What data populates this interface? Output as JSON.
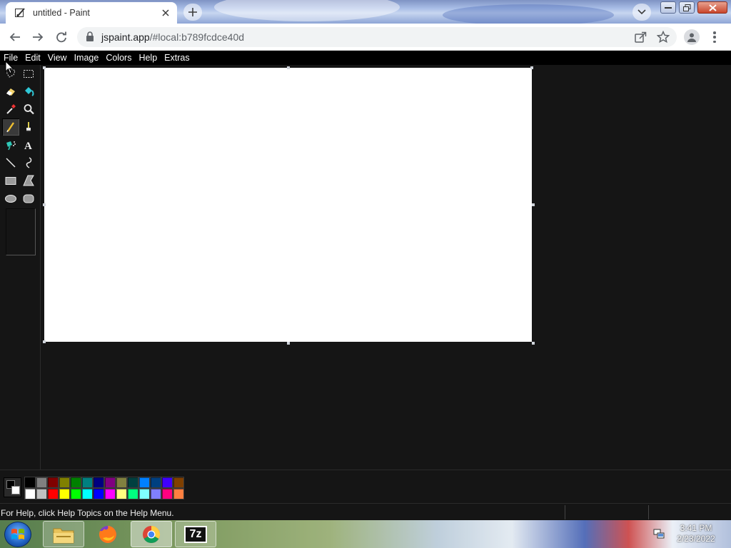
{
  "browser": {
    "tab_title": "untitled - Paint",
    "url_host": "jspaint.app",
    "url_path": "/#local:b789fcdce40d"
  },
  "menubar": {
    "file": "File",
    "edit": "Edit",
    "view": "View",
    "image": "Image",
    "colors": "Colors",
    "help": "Help",
    "extras": "Extras"
  },
  "tools": {
    "selected": "pencil",
    "items": [
      "free-form-select",
      "select",
      "eraser",
      "fill-with-color",
      "pick-color",
      "magnifier",
      "pencil",
      "brush",
      "airbrush",
      "text",
      "line",
      "curve",
      "rectangle",
      "polygon",
      "ellipse",
      "rounded-rectangle"
    ]
  },
  "colors": {
    "foreground": "#000000",
    "background": "#ffffff",
    "palette_top": [
      "#000000",
      "#808080",
      "#800000",
      "#808000",
      "#008000",
      "#008080",
      "#000080",
      "#800080",
      "#808040",
      "#004040",
      "#0080ff",
      "#004080",
      "#4000ff",
      "#804000"
    ],
    "palette_bottom": [
      "#ffffff",
      "#c0c0c0",
      "#ff0000",
      "#ffff00",
      "#00ff00",
      "#00ffff",
      "#0000ff",
      "#ff00ff",
      "#ffff80",
      "#00ff80",
      "#80ffff",
      "#8080ff",
      "#ff0080",
      "#ff8040"
    ]
  },
  "status": {
    "help_text": "For Help, click Help Topics on the Help Menu."
  },
  "taskbar": {
    "apps": [
      "explorer-icon",
      "firefox-icon",
      "chrome-icon",
      "7zip-icon"
    ],
    "sevenzip_label": "7z",
    "time": "3:41 PM",
    "date": "2/23/2022"
  }
}
